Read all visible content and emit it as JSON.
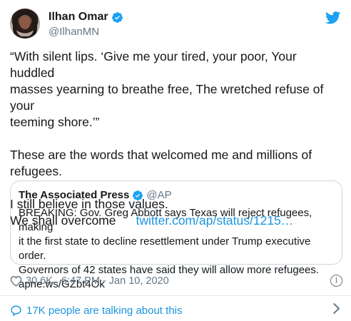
{
  "author": {
    "name": "Ilhan Omar",
    "handle": "@IlhanMN",
    "verified_icon": "verified-badge-icon",
    "avatar": "profile-photo"
  },
  "tweet": {
    "line1": "“With silent lips. ‘Give me your tired, your poor, Your huddled",
    "line2": "masses yearning to breathe free, The wretched refuse of your",
    "line3": "teeming shore.’”",
    "para2": "These are the words that welcomed me and millions of refugees.",
    "para3": "I still believe in those values.",
    "para4": "We shall overcome",
    "link": "twitter.com/ap/status/1215…"
  },
  "quoted": {
    "name": "The Associated Press",
    "handle": "@AP",
    "line1": "BREAKING: Gov. Greg Abbott says Texas will reject refugees, making",
    "line2": "it the first state to decline resettlement under Trump executive order.",
    "line3": "Governors of 42 states have said they will allow more refugees.",
    "line4": "apne.ws/GZbt4Ok"
  },
  "meta": {
    "likes": "30.6K",
    "timestamp": "6:47 PM - Jan 10, 2020",
    "info_glyph": "i"
  },
  "footer": {
    "talking": "17K people are talking about this"
  },
  "colors": {
    "link": "#1b95e0",
    "secondary": "#657786",
    "text": "#14171a",
    "border": "#ccd6dd"
  }
}
